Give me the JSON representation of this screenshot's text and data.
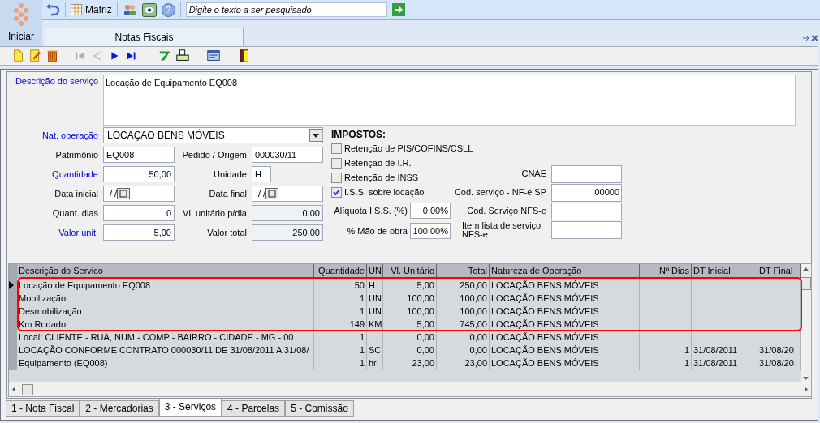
{
  "ribbon": {
    "start_button": "Iniciar",
    "matrix_button": "Matriz",
    "help_button": "?",
    "search": {
      "placeholder": "Digite o texto a ser pesquisado"
    }
  },
  "document_tabs": [
    {
      "label": "Notas Fiscais",
      "selected": true
    }
  ],
  "toolbar": [
    {
      "kind": "new",
      "disabled": false
    },
    {
      "kind": "edit",
      "disabled": false
    },
    {
      "kind": "delete",
      "disabled": false
    },
    {
      "kind": "first",
      "disabled": true
    },
    {
      "kind": "prev",
      "disabled": true
    },
    {
      "kind": "next",
      "disabled": false
    },
    {
      "kind": "last",
      "disabled": false
    },
    {
      "kind": "confirm",
      "disabled": false
    },
    {
      "kind": "print",
      "disabled": false
    },
    {
      "kind": "window",
      "disabled": false
    },
    {
      "kind": "exit",
      "disabled": false
    }
  ],
  "form": {
    "description": {
      "label": "Descrição do serviço",
      "value": "Locação de Equipamento EQ008",
      "required": true
    },
    "nature": {
      "label": "Nat. operação",
      "value": "LOCAÇÃO BENS MÓVEIS",
      "required": true
    },
    "rows": [
      {
        "left": {
          "label": "Patrimônio",
          "value": "EQ008",
          "required": false,
          "kind": "text"
        },
        "right": {
          "label": "Pedido / Origem",
          "value": "000030/11",
          "required": false,
          "kind": "text"
        }
      },
      {
        "left": {
          "label": "Quantidade",
          "value": "50,00",
          "required": true,
          "kind": "number"
        },
        "right": {
          "label": "Unidade",
          "value": "H",
          "required": false,
          "kind": "short"
        }
      },
      {
        "left": {
          "label": "Data inicial",
          "value": "/ /",
          "required": false,
          "kind": "date"
        },
        "right": {
          "label": "Data final",
          "value": "/ /",
          "required": false,
          "kind": "date"
        }
      },
      {
        "left": {
          "label": "Quant. dias",
          "value": "0",
          "required": false,
          "kind": "number"
        },
        "right": {
          "label": "Vl. unitário p/dia",
          "value": "0,00",
          "required": false,
          "kind": "number",
          "readonly": true
        }
      },
      {
        "left": {
          "label": "Valor unit.",
          "value": "5,00",
          "required": true,
          "kind": "number"
        },
        "right": {
          "label": "Valor total",
          "value": "250,00",
          "required": false,
          "kind": "number",
          "readonly": true
        }
      }
    ],
    "taxes": {
      "title": "IMPOSTOS:",
      "checkboxes": [
        {
          "label": "Retenção de PIS/COFINS/CSLL",
          "checked": false
        },
        {
          "label": "Retenção de I.R.",
          "checked": false
        },
        {
          "label": "Retenção de INSS",
          "checked": false
        },
        {
          "label": "I.S.S. sobre locação",
          "checked": true
        }
      ],
      "percent_fields": [
        {
          "label": "Alíquota I.S.S. (%)",
          "value": "0,00%"
        },
        {
          "label": "% Mão de obra",
          "value": "100,00%"
        }
      ]
    },
    "codes": [
      {
        "label": "CNAE"
      },
      {
        "label": "Cod. serviço - NF-e SP",
        "value": "00000"
      },
      {
        "label": "Cod. Serviço NFS-e"
      },
      {
        "label": "Item lista de serviço NFS-e"
      }
    ]
  },
  "table": {
    "columns": [
      "Descrição do Servico",
      "Quantidade",
      "UN",
      "Vl. Unitário",
      "Total",
      "Natureza de Operação",
      "Nº Dias",
      "DT Inicial",
      "DT Final"
    ],
    "rows": [
      {
        "current": true,
        "highlighted": true,
        "cells": [
          "Locação de Equipamento EQ008",
          "50",
          "H",
          "5,00",
          "250,00",
          "LOCAÇÃO BENS MÓVEIS",
          null,
          null,
          null
        ]
      },
      {
        "current": false,
        "highlighted": true,
        "cells": [
          "Mobilização",
          "1",
          "UN",
          "100,00",
          "100,00",
          "LOCAÇÃO BENS MÓVEIS",
          null,
          null,
          null
        ]
      },
      {
        "current": false,
        "highlighted": true,
        "cells": [
          "Desmobilização",
          "1",
          "UN",
          "100,00",
          "100,00",
          "LOCAÇÃO BENS MÓVEIS",
          null,
          null,
          null
        ]
      },
      {
        "current": false,
        "highlighted": true,
        "cells": [
          "Km Rodado",
          "149",
          "KM",
          "5,00",
          "745,00",
          "LOCAÇÃO BENS MÓVEIS",
          null,
          null,
          null
        ]
      },
      {
        "current": false,
        "highlighted": false,
        "cells": [
          "Local: CLIENTE - RUA, NUM - COMP - BAIRRO - CIDADE - MG - 00",
          "1",
          null,
          "0,00",
          "0,00",
          "LOCAÇÃO BENS MÓVEIS",
          null,
          null,
          null
        ]
      },
      {
        "current": false,
        "highlighted": false,
        "cells": [
          "LOCAÇÃO CONFORME CONTRATO 000030/11 DE 31/08/2011 A 31/08/",
          "1",
          "SC",
          "0,00",
          "0,00",
          "LOCAÇÃO BENS MÓVEIS",
          "1",
          "31/08/2011",
          "31/08/20"
        ]
      },
      {
        "current": false,
        "highlighted": false,
        "cells": [
          "Equipamento  (EQ008)",
          "1",
          "hr",
          "23,00",
          "23,00",
          "LOCAÇÃO BENS MÓVEIS",
          "1",
          "31/08/2011",
          "31/08/20"
        ]
      }
    ]
  },
  "section_tabs": [
    {
      "label": "1 - Nota Fiscal",
      "selected": false
    },
    {
      "label": "2 - Mercadorias",
      "selected": false
    },
    {
      "label": "3 - Serviços",
      "selected": true
    },
    {
      "label": "4 - Parcelas",
      "selected": false
    },
    {
      "label": "5 - Comissão",
      "selected": false
    }
  ]
}
